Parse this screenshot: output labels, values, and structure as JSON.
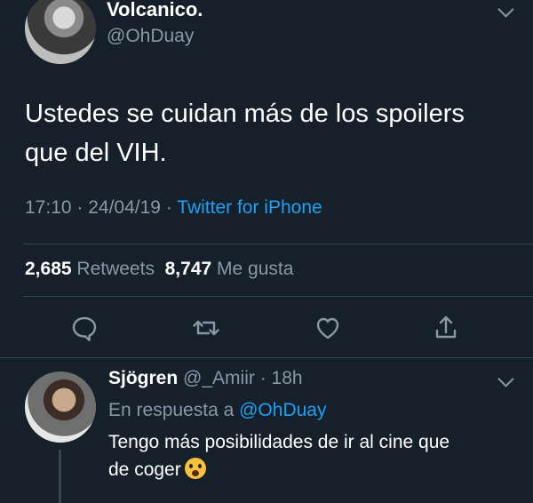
{
  "tweet": {
    "display_name": "Volcanico.",
    "handle": "@OhDuay",
    "text_line1": "Ustedes se cuidan más de los spoilers",
    "text_line2": "que del VIH.",
    "time": "17:10",
    "date": "24/04/19",
    "source": "Twitter for iPhone",
    "retweets_count": "2,685",
    "retweets_label": "Retweets",
    "likes_count": "8,747",
    "likes_label": "Me gusta"
  },
  "reply": {
    "display_name": "Sjögren",
    "handle": "@_Amiir",
    "age": "18h",
    "replying_prefix": "En respuesta a",
    "replying_handle": "@OhDuay",
    "text_line1": "Tengo más posibilidades de ir al cine que",
    "text_line2": "de coger",
    "emoji": "scream-emoji"
  },
  "colors": {
    "background": "#15202b",
    "accent": "#1da1f2",
    "muted": "#8899a6",
    "divider": "#38444d"
  },
  "icons": [
    "reply-icon",
    "retweet-icon",
    "like-icon",
    "share-icon",
    "chevron-down-icon"
  ]
}
